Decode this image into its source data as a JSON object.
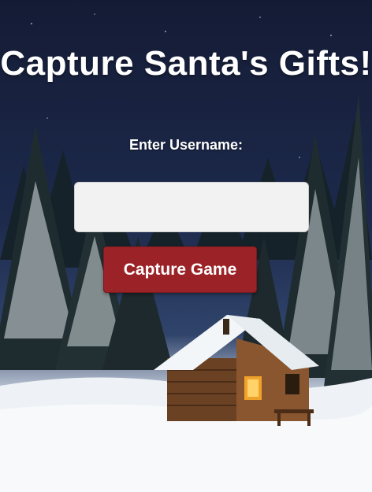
{
  "page": {
    "title": "Capture Santa's Gifts!",
    "username_label": "Enter Username:",
    "username_input": {
      "value": "",
      "placeholder": ""
    },
    "submit_label": "Capture Game"
  },
  "colors": {
    "button_bg": "#9b2226",
    "input_bg": "#f2f2f2",
    "text": "#ffffff",
    "sky": "#1b2444"
  },
  "background": {
    "scene": "snowy night forest with log cabin"
  }
}
